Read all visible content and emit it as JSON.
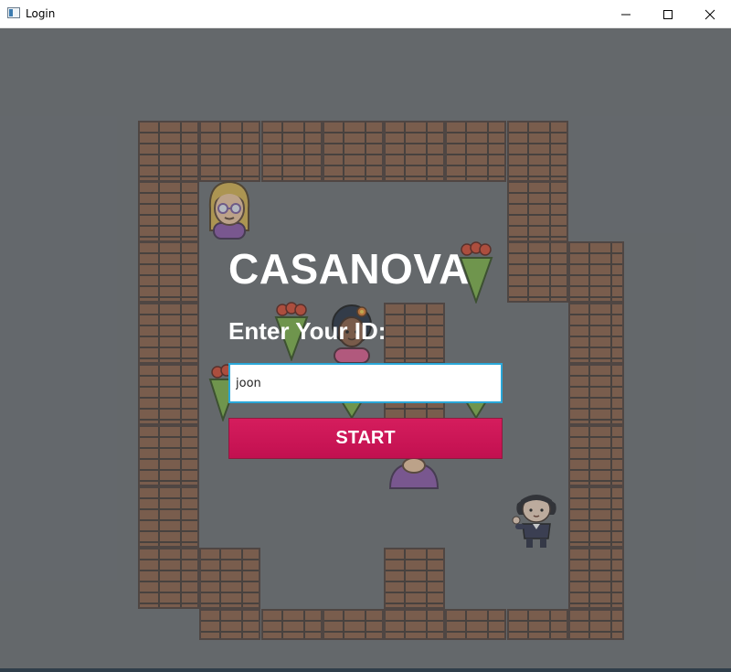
{
  "window": {
    "title": "Login",
    "app_icon": "window-app-icon",
    "controls": [
      "minimize-icon",
      "maximize-icon",
      "close-icon"
    ]
  },
  "login": {
    "title": "CASANOVA",
    "id_label": "Enter Your ID:",
    "id_value": "joon",
    "start_label": "START"
  },
  "game_sprites": [
    "girl-sprite-blonde",
    "girl-sprite-flower-hair",
    "girl-sprite-purple",
    "player-casanova-sprite",
    "rose-bouquet-sprite"
  ],
  "colors": {
    "background": "#6a6e71",
    "brick": "#8a5d42",
    "start_button": "#c8155a",
    "input_focus": "#2aa7d8",
    "text": "#ffffff"
  }
}
